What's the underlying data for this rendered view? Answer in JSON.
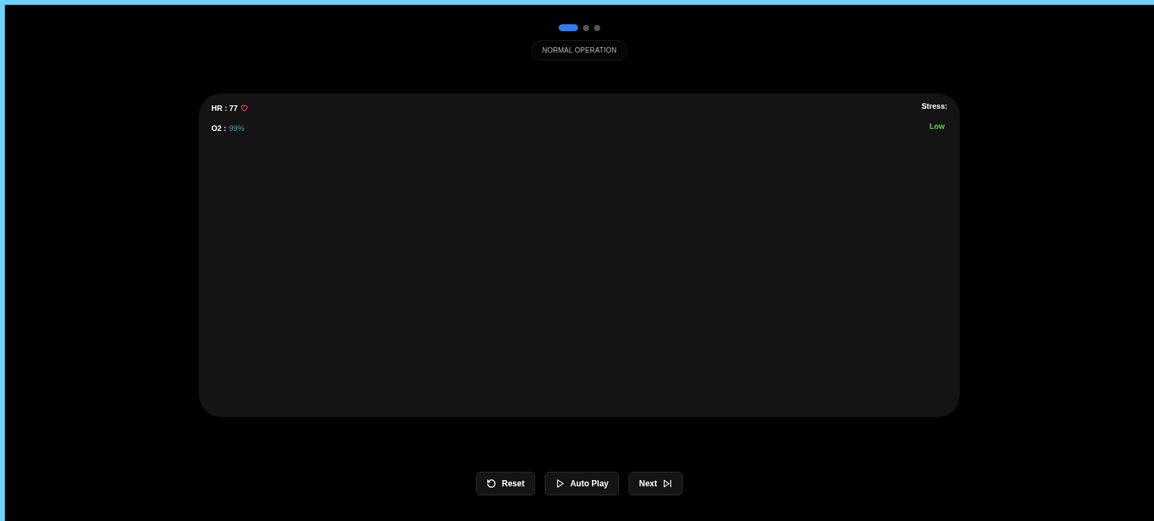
{
  "pager": [
    {
      "selected": true
    },
    {
      "selected": false
    },
    {
      "selected": false
    }
  ],
  "mode_badge": "NORMAL OPERATION",
  "vitals": {
    "hr_label": "HR : 77",
    "o2_label": "O2 :",
    "o2_value": "99%"
  },
  "stress": {
    "label": "Stress:",
    "value": "Low"
  },
  "buttons": [
    {
      "label": "Reset",
      "kind": "reset"
    },
    {
      "label": "Auto Play",
      "kind": "play"
    },
    {
      "label": "Next",
      "kind": "next"
    }
  ]
}
